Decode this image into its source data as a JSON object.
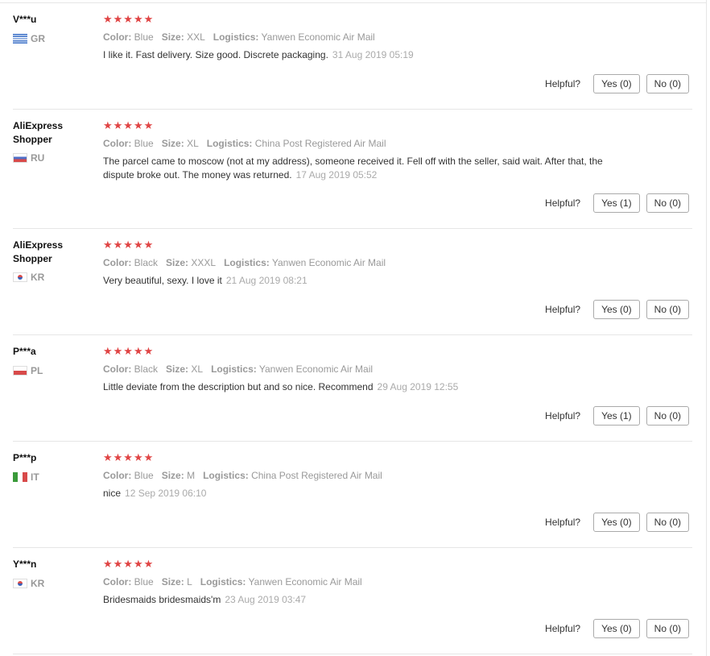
{
  "labels": {
    "color": "Color:",
    "size": "Size:",
    "logistics": "Logistics:",
    "helpful": "Helpful?",
    "stars": "★★★★★"
  },
  "reviews": [
    {
      "user": "V***u",
      "country": "GR",
      "flag_icon": "greece-flag-icon",
      "rating": 5,
      "color": "Blue",
      "size": "XXL",
      "logistics": "Yanwen Economic Air Mail",
      "text": "I like it. Fast delivery. Size good. Discrete packaging.",
      "date": "31 Aug 2019 05:19",
      "yes": "Yes (0)",
      "no": "No (0)"
    },
    {
      "user": "AliExpress Shopper",
      "country": "RU",
      "flag_icon": "russia-flag-icon",
      "rating": 5,
      "color": "Blue",
      "size": "XL",
      "logistics": "China Post Registered Air Mail",
      "text": "The parcel came to moscow (not at my address), someone received it. Fell off with the seller, said wait. After that, the dispute broke out. The money was returned.",
      "date": "17 Aug 2019 05:52",
      "yes": "Yes (1)",
      "no": "No (0)"
    },
    {
      "user": "AliExpress Shopper",
      "country": "KR",
      "flag_icon": "south-korea-flag-icon",
      "rating": 5,
      "color": "Black",
      "size": "XXXL",
      "logistics": "Yanwen Economic Air Mail",
      "text": "Very beautiful, sexy. I love it",
      "date": "21 Aug 2019 08:21",
      "yes": "Yes (0)",
      "no": "No (0)"
    },
    {
      "user": "P***a",
      "country": "PL",
      "flag_icon": "poland-flag-icon",
      "rating": 5,
      "color": "Black",
      "size": "XL",
      "logistics": "Yanwen Economic Air Mail",
      "text": "Little deviate from the description but and so nice. Recommend",
      "date": "29 Aug 2019 12:55",
      "yes": "Yes (1)",
      "no": "No (0)"
    },
    {
      "user": "P***p",
      "country": "IT",
      "flag_icon": "italy-flag-icon",
      "rating": 5,
      "color": "Blue",
      "size": "M",
      "logistics": "China Post Registered Air Mail",
      "text": "nice",
      "date": "12 Sep 2019 06:10",
      "yes": "Yes (0)",
      "no": "No (0)"
    },
    {
      "user": "Y***n",
      "country": "KR",
      "flag_icon": "south-korea-flag-icon",
      "rating": 5,
      "color": "Blue",
      "size": "L",
      "logistics": "Yanwen Economic Air Mail",
      "text": "Bridesmaids bridesmaids'm",
      "date": "23 Aug 2019 03:47",
      "yes": "Yes (0)",
      "no": "No (0)"
    }
  ],
  "colors": {
    "star": "#e04444",
    "muted": "#999999",
    "divider": "#e6e6e6"
  }
}
